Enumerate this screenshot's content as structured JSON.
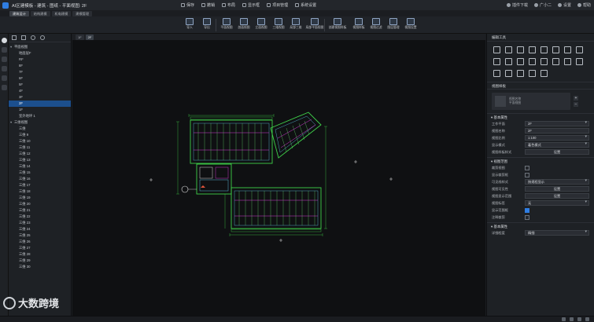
{
  "window": {
    "title": "AI区建模板 - 建筑 - 图纸 - 平面视图: 2F"
  },
  "top_menu": {
    "items": [
      {
        "label": "保存",
        "icon": "save-icon"
      },
      {
        "label": "撤销",
        "icon": "undo-icon"
      },
      {
        "label": "布局",
        "icon": "layout-icon"
      },
      {
        "label": "显示框",
        "icon": "display-icon"
      },
      {
        "label": "项目管理",
        "icon": "project-icon"
      },
      {
        "label": "系统设置",
        "icon": "settings-icon"
      }
    ],
    "right": [
      {
        "label": "插件下载"
      },
      {
        "label": "广小二"
      },
      {
        "label": "设置"
      },
      {
        "label": "帮助"
      }
    ]
  },
  "sub_tabs": [
    "建筑设计",
    "结构建模",
    "机电建模",
    "建模管理"
  ],
  "ribbon": {
    "buttons": [
      {
        "label": "导入"
      },
      {
        "label": "导出"
      },
      {
        "label": "平面视图"
      },
      {
        "label": "剖面视图"
      },
      {
        "label": "立面视图"
      },
      {
        "label": "三维视图"
      },
      {
        "label": "局部三维"
      },
      {
        "label": "局部平面视图"
      },
      {
        "label": "创建视图样板"
      },
      {
        "label": "视图样板"
      },
      {
        "label": "视图过滤"
      },
      {
        "label": "图层管理"
      },
      {
        "label": "视图设置"
      }
    ]
  },
  "tree": {
    "nodes": [
      {
        "label": "平面视图",
        "caret": "▾",
        "indent": 0
      },
      {
        "label": "地面层F",
        "caret": "",
        "indent": 2
      },
      {
        "label": "RF",
        "caret": "",
        "indent": 2
      },
      {
        "label": "8F",
        "caret": "",
        "indent": 2
      },
      {
        "label": "7F",
        "caret": "",
        "indent": 2
      },
      {
        "label": "6F",
        "caret": "",
        "indent": 2
      },
      {
        "label": "5F",
        "caret": "",
        "indent": 2
      },
      {
        "label": "4F",
        "caret": "",
        "indent": 2
      },
      {
        "label": "3F",
        "caret": "",
        "indent": 2
      },
      {
        "label": "2F",
        "caret": "",
        "indent": 2,
        "selected": true
      },
      {
        "label": "1F",
        "caret": "",
        "indent": 2
      },
      {
        "label": "室外地坪 1",
        "caret": "",
        "indent": 2
      },
      {
        "label": "三维视图",
        "caret": "▾",
        "indent": 0
      },
      {
        "label": "三维",
        "caret": "",
        "indent": 2
      },
      {
        "label": "三维 9",
        "caret": "",
        "indent": 2
      },
      {
        "label": "三维 10",
        "caret": "",
        "indent": 2
      },
      {
        "label": "三维 11",
        "caret": "",
        "indent": 2
      },
      {
        "label": "三维 12",
        "caret": "",
        "indent": 2
      },
      {
        "label": "三维 13",
        "caret": "",
        "indent": 2
      },
      {
        "label": "三维 14",
        "caret": "",
        "indent": 2
      },
      {
        "label": "三维 15",
        "caret": "",
        "indent": 2
      },
      {
        "label": "三维 16",
        "caret": "",
        "indent": 2
      },
      {
        "label": "三维 17",
        "caret": "",
        "indent": 2
      },
      {
        "label": "三维 18",
        "caret": "",
        "indent": 2
      },
      {
        "label": "三维 19",
        "caret": "",
        "indent": 2
      },
      {
        "label": "三维 20",
        "caret": "",
        "indent": 2
      },
      {
        "label": "三维 21",
        "caret": "",
        "indent": 2
      },
      {
        "label": "三维 22",
        "caret": "",
        "indent": 2
      },
      {
        "label": "三维 23",
        "caret": "",
        "indent": 2
      },
      {
        "label": "三维 24",
        "caret": "",
        "indent": 2
      },
      {
        "label": "三维 25",
        "caret": "",
        "indent": 2
      },
      {
        "label": "三维 26",
        "caret": "",
        "indent": 2
      },
      {
        "label": "三维 27",
        "caret": "",
        "indent": 2
      },
      {
        "label": "三维 28",
        "caret": "",
        "indent": 2
      },
      {
        "label": "三维 29",
        "caret": "",
        "indent": 2
      },
      {
        "label": "三维 30",
        "caret": "",
        "indent": 2
      }
    ]
  },
  "canvas_tabs": [
    {
      "label": "1F",
      "active": false
    },
    {
      "label": "2F",
      "active": true
    }
  ],
  "right_panel": {
    "tools_title": "编辑工具",
    "view_sample_title": "视图样板",
    "view_sample_text": [
      "视图名称",
      "平面视图"
    ],
    "basic_props_title": "基本属性",
    "props": [
      {
        "label": "工作平面",
        "value": "2F",
        "kind": "dd"
      },
      {
        "label": "视图名称",
        "value": "2F",
        "kind": "text"
      },
      {
        "label": "视图比例",
        "value": "1:100",
        "kind": "dd"
      },
      {
        "label": "显示模式",
        "value": "着色模式",
        "kind": "dd"
      },
      {
        "label": "视图样板样式",
        "value": "设置",
        "kind": "btn"
      }
    ],
    "view_range_title": "视图范围",
    "range_props": [
      {
        "label": "裁剪视图",
        "kind": "cb",
        "checked": false
      },
      {
        "label": "显示裁剪框",
        "kind": "cb",
        "checked": false
      },
      {
        "label": "可见线样式",
        "value": "按规程显示",
        "kind": "dd"
      },
      {
        "label": "视图可见性",
        "value": "设置",
        "kind": "btn"
      },
      {
        "label": "视图显示范围",
        "value": "设置",
        "kind": "btn"
      },
      {
        "label": "视图标签",
        "value": "无",
        "kind": "dd"
      },
      {
        "label": "显示范围框",
        "kind": "cb",
        "checked": true
      },
      {
        "label": "注释裁剪",
        "kind": "cb",
        "checked": false
      }
    ],
    "other_title": "基本属性",
    "other_props": [
      {
        "label": "详细程度",
        "value": "精细",
        "kind": "dd"
      }
    ]
  },
  "watermark": {
    "text": "大数跨境"
  },
  "colors": {
    "accent": "#2f7de1",
    "plan_green": "#3fd14a",
    "plan_magenta": "#d63bd6",
    "plan_cyan": "#5fc6e6"
  }
}
